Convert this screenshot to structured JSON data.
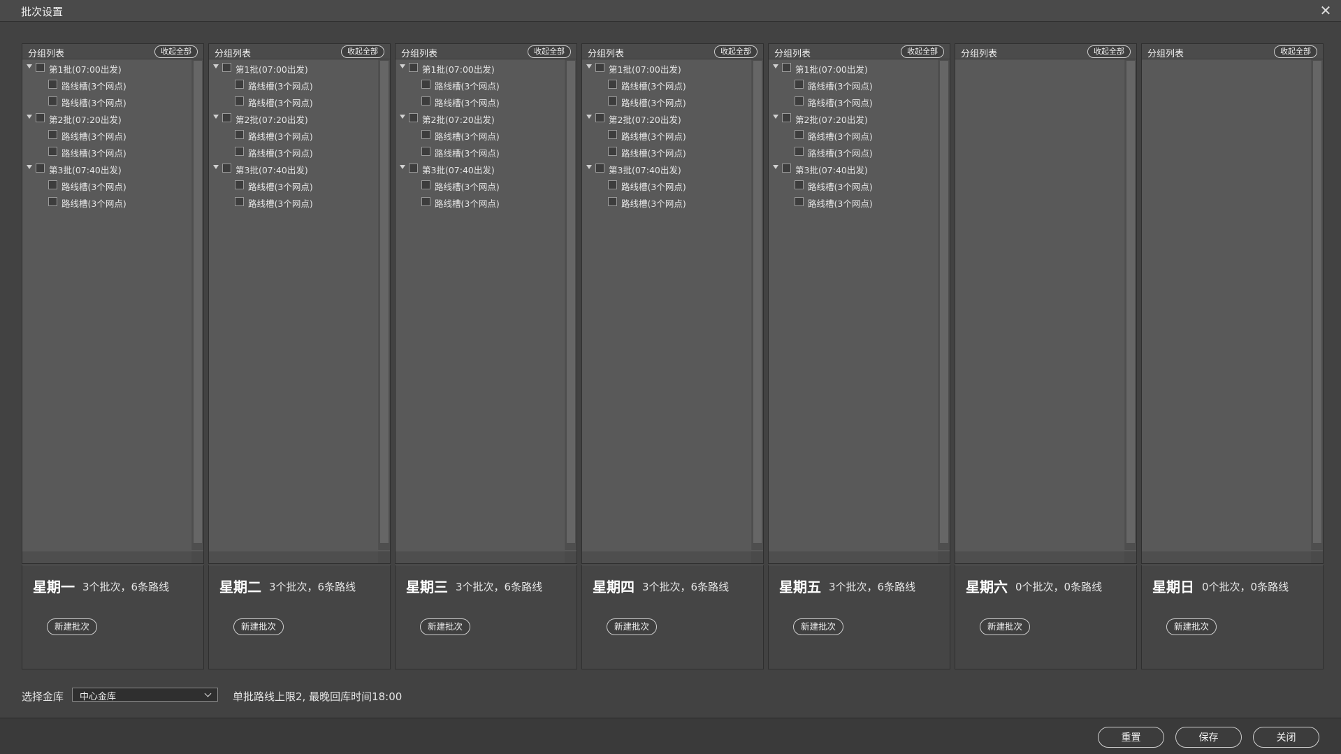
{
  "window": {
    "title": "批次设置"
  },
  "icons": {
    "close": "close-icon",
    "expand": "caret-down-icon",
    "select": "chevron-down-icon"
  },
  "panel": {
    "title": "分组列表",
    "collapse_label": "收起全部",
    "new_batch_label": "新建批次"
  },
  "days": [
    {
      "name": "星期一",
      "stats": "3个批次，6条路线",
      "batches": [
        {
          "label": "第1批(07:00出发)",
          "routes": [
            "路线槽(3个网点)",
            "路线槽(3个网点)"
          ]
        },
        {
          "label": "第2批(07:20出发)",
          "routes": [
            "路线槽(3个网点)",
            "路线槽(3个网点)"
          ]
        },
        {
          "label": "第3批(07:40出发)",
          "routes": [
            "路线槽(3个网点)",
            "路线槽(3个网点)"
          ]
        }
      ]
    },
    {
      "name": "星期二",
      "stats": "3个批次，6条路线",
      "batches": [
        {
          "label": "第1批(07:00出发)",
          "routes": [
            "路线槽(3个网点)",
            "路线槽(3个网点)"
          ]
        },
        {
          "label": "第2批(07:20出发)",
          "routes": [
            "路线槽(3个网点)",
            "路线槽(3个网点)"
          ]
        },
        {
          "label": "第3批(07:40出发)",
          "routes": [
            "路线槽(3个网点)",
            "路线槽(3个网点)"
          ]
        }
      ]
    },
    {
      "name": "星期三",
      "stats": "3个批次，6条路线",
      "batches": [
        {
          "label": "第1批(07:00出发)",
          "routes": [
            "路线槽(3个网点)",
            "路线槽(3个网点)"
          ]
        },
        {
          "label": "第2批(07:20出发)",
          "routes": [
            "路线槽(3个网点)",
            "路线槽(3个网点)"
          ]
        },
        {
          "label": "第3批(07:40出发)",
          "routes": [
            "路线槽(3个网点)",
            "路线槽(3个网点)"
          ]
        }
      ]
    },
    {
      "name": "星期四",
      "stats": "3个批次，6条路线",
      "batches": [
        {
          "label": "第1批(07:00出发)",
          "routes": [
            "路线槽(3个网点)",
            "路线槽(3个网点)"
          ]
        },
        {
          "label": "第2批(07:20出发)",
          "routes": [
            "路线槽(3个网点)",
            "路线槽(3个网点)"
          ]
        },
        {
          "label": "第3批(07:40出发)",
          "routes": [
            "路线槽(3个网点)",
            "路线槽(3个网点)"
          ]
        }
      ]
    },
    {
      "name": "星期五",
      "stats": "3个批次，6条路线",
      "batches": [
        {
          "label": "第1批(07:00出发)",
          "routes": [
            "路线槽(3个网点)",
            "路线槽(3个网点)"
          ]
        },
        {
          "label": "第2批(07:20出发)",
          "routes": [
            "路线槽(3个网点)",
            "路线槽(3个网点)"
          ]
        },
        {
          "label": "第3批(07:40出发)",
          "routes": [
            "路线槽(3个网点)",
            "路线槽(3个网点)"
          ]
        }
      ]
    },
    {
      "name": "星期六",
      "stats": "0个批次，0条路线",
      "batches": []
    },
    {
      "name": "星期日",
      "stats": "0个批次，0条路线",
      "batches": []
    }
  ],
  "footer": {
    "vault_label": "选择金库",
    "vault_selected": "中心金库",
    "limit_text": "单批路线上限2, 最晚回库时间18:00"
  },
  "buttons": {
    "reset": "重置",
    "save": "保存",
    "close": "关闭"
  }
}
